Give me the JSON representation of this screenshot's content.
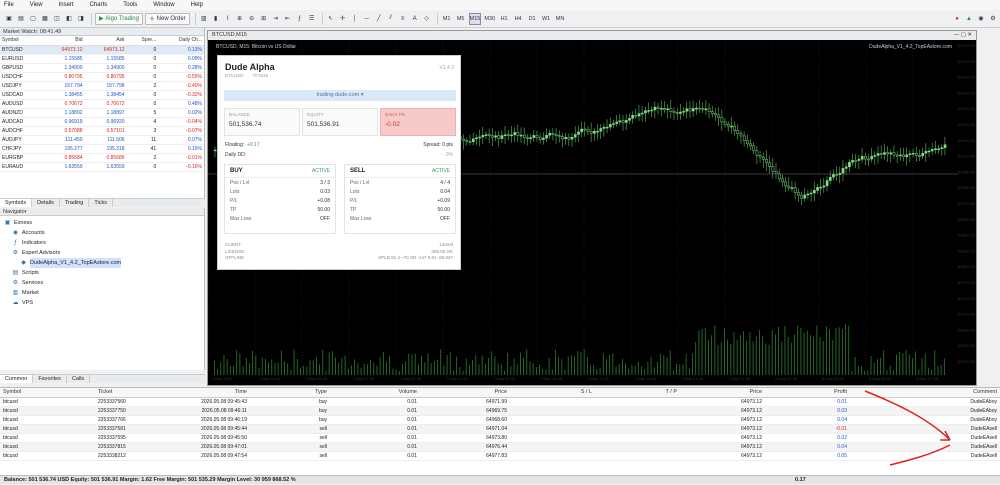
{
  "menu": [
    "File",
    "View",
    "Insert",
    "Charts",
    "Tools",
    "Window",
    "Help"
  ],
  "toolbar": {
    "algo_trading": "Algo Trading",
    "new_order": "New Order",
    "timeframes": [
      "M1",
      "M5",
      "M15",
      "M30",
      "H1",
      "H4",
      "D1",
      "W1",
      "MN"
    ],
    "active_timeframe": "M15"
  },
  "market_watch": {
    "title": "Market Watch: 08:41:49",
    "headers": [
      "Symbol",
      "Bid",
      "Ask",
      "Spre...",
      "Daily Ch..."
    ],
    "rows": [
      [
        "BTCUSD",
        "64973.12",
        "64973.12",
        "0",
        "0.13%"
      ],
      [
        "EURUSD",
        "1.15585",
        "1.15585",
        "0",
        "0.09%"
      ],
      [
        "GBPUSD",
        "1.34900",
        "1.34900",
        "0",
        "0.28%"
      ],
      [
        "USDCHF",
        "0.80795",
        "0.80795",
        "0",
        "-0.55%"
      ],
      [
        "USDJPY",
        "157.794",
        "157.798",
        "2",
        "-0.40%"
      ],
      [
        "USDCAD",
        "1.38455",
        "1.38454",
        "0",
        "-0.32%"
      ],
      [
        "AUDUSD",
        "0.70672",
        "0.70672",
        "0",
        "0.48%"
      ],
      [
        "AUDNZD",
        "1.18892",
        "1.18897",
        "5",
        "0.02%"
      ],
      [
        "AUDCAD",
        "0.96919",
        "0.96920",
        "4",
        "-0.04%"
      ],
      [
        "AUDCHF",
        "0.57088",
        "0.57101",
        "3",
        "-0.07%"
      ],
      [
        "AUDJPY",
        "111.450",
        "111.506",
        "11",
        "0.07%"
      ],
      [
        "CHFJPY",
        "195.277",
        "195.318",
        "41",
        "0.15%"
      ],
      [
        "EURGBP",
        "0.85684",
        "0.85686",
        "2",
        "-0.01%"
      ],
      [
        "EURAUD",
        "1.63559",
        "1.63559",
        "0",
        "-0.16%"
      ]
    ],
    "tabs": [
      "Symbols",
      "Details",
      "Trading",
      "Ticks"
    ]
  },
  "navigator": {
    "title": "Navigator",
    "items": [
      {
        "label": "Exness",
        "level": 0,
        "icon": "folder-icon"
      },
      {
        "label": "Accounts",
        "level": 1,
        "icon": "accounts-icon"
      },
      {
        "label": "Indicators",
        "level": 1,
        "icon": "indicators-icon"
      },
      {
        "label": "Expert Advisors",
        "level": 1,
        "icon": "expert-icon"
      },
      {
        "label": "DudeAlpha_V1_4.2_TopEAstore.com",
        "level": 2,
        "icon": "ea-icon",
        "selected": true
      },
      {
        "label": "Scripts",
        "level": 1,
        "icon": "scripts-icon"
      },
      {
        "label": "Services",
        "level": 1,
        "icon": "services-icon"
      },
      {
        "label": "Market",
        "level": 1,
        "icon": "market-icon"
      },
      {
        "label": "VPS",
        "level": 1,
        "icon": "vps-icon"
      }
    ]
  },
  "chart": {
    "title": "BTCUSD,M15",
    "subtitle": "BTCUSD, M15: Bitcoin vs US Dollar",
    "ea_label": "DudeAlpha_V1_4.2_TopEAstore.com",
    "price_ticks": [
      "64220.00",
      "64190.00",
      "64160.00",
      "64130.00",
      "64100.00",
      "64070.00",
      "64040.00",
      "64010.00",
      "63980.00",
      "63950.00",
      "63920.00",
      "63890.00",
      "63860.00",
      "63830.00",
      "63800.00",
      "63770.00",
      "63740.00",
      "63710.00",
      "63680.00",
      "63650.00",
      "63620.00"
    ],
    "time_ticks": [
      "7 May 2026",
      "7 May 03:45",
      "7 May 05:45",
      "7 May 07:45",
      "7 May 09:45",
      "7 May 11:45",
      "7 May 13:45",
      "7 May 15:45",
      "7 May 17:45",
      "7 May 19:45",
      "7 May 21:45",
      "7 May 23:45",
      "8 May 01:45",
      "8 May 03:45",
      "8 May 05:45",
      "8 May 07:45"
    ],
    "colors": {
      "background": "#000000",
      "bull": "#7ee081",
      "bear": "#3fa34d",
      "volume": "#2e7d32"
    }
  },
  "panel": {
    "title": "Dude Alpha",
    "version": "V1.4.2",
    "sub_left": "BTCUSD",
    "sub_right": "TF:M15",
    "banner": "trading-dude.com",
    "boxes": [
      {
        "label": "BALANCE",
        "value": "501,536.74"
      },
      {
        "label": "EQUITY",
        "value": "501,536.91"
      },
      {
        "label": "DAILY P/L",
        "value": "-0.02"
      }
    ],
    "floating_label": "Floating:",
    "floating_value": "+0.17",
    "spread": "Spread: 0 pts",
    "daily_dd_label": "Daily DD:",
    "daily_dd_value": "0%",
    "buy": {
      "title": "BUY",
      "status": "ACTIVE",
      "rows": [
        [
          "Pos / Lvl",
          "3 / 3"
        ],
        [
          "Lots",
          "0.03"
        ],
        [
          "P/L",
          "+0.08"
        ],
        [
          "TP",
          "50.00"
        ],
        [
          "Max Loss",
          "OFF"
        ]
      ]
    },
    "sell": {
      "title": "SELL",
      "status": "ACTIVE",
      "rows": [
        [
          "Pos / Lvl",
          "4 / 4"
        ],
        [
          "Lots",
          "0.04"
        ],
        [
          "P/L",
          "+0.09"
        ],
        [
          "TP",
          "50.00"
        ],
        [
          "Max Loss",
          "OFF"
        ]
      ]
    },
    "footer_left": [
      "CLIENT",
      "LICENSE",
      "OFFLINE"
    ],
    "footer_right": [
      "12/end",
      "000.00 OK",
      "SPLD 91.4 ~70 SD -147 9.81 -86.047"
    ]
  },
  "toolbox_tabs": [
    "Common",
    "Favorites",
    "Calls"
  ],
  "trade": {
    "headers": [
      "Symbol",
      "Ticket",
      "Time",
      "Type",
      "Volume",
      "Price",
      "S / L",
      "T / P",
      "Price",
      "Profit",
      "Comment"
    ],
    "rows": [
      [
        "btcusd",
        "2253337560",
        "2026.05.08 09:45:43",
        "buy",
        "0.01",
        "64971.99",
        "",
        "",
        "64973.12",
        "0.01",
        "DudeEAboy"
      ],
      [
        "btcusd",
        "2253337750",
        "2026.05.08 09:46:11",
        "buy",
        "0.01",
        "64969.75",
        "",
        "",
        "64973.12",
        "0.03",
        "DudeEAboy"
      ],
      [
        "btcusd",
        "2253337766",
        "2026.05.08 09:46:19",
        "buy",
        "0.01",
        "64968.60",
        "",
        "",
        "64973.12",
        "0.04",
        "DudeEAboy"
      ],
      [
        "btcusd",
        "2253337581",
        "2026.05.08 09:45:44",
        "sell",
        "0.01",
        "64971.04",
        "",
        "",
        "64973.12",
        "-0.01",
        "DudeEAsell"
      ],
      [
        "btcusd",
        "2253337595",
        "2026.05.08 09:45:50",
        "sell",
        "0.01",
        "64973.80",
        "",
        "",
        "64973.12",
        "0.02",
        "DudeEAsell"
      ],
      [
        "btcusd",
        "2253337815",
        "2026.05.08 09:47:01",
        "sell",
        "0.01",
        "64976.44",
        "",
        "",
        "64973.12",
        "0.04",
        "DudeEAsell"
      ],
      [
        "btcusd",
        "2253338212",
        "2026.05.08 09:47:54",
        "sell",
        "0.01",
        "64977.83",
        "",
        "",
        "64973.12",
        "0.05",
        "DudeEAsell"
      ]
    ]
  },
  "status": {
    "text": "Balance: 501 536.74 USD  Equity: 501 536.91  Margin: 1.62  Free Margin: 501 535.29  Margin Level: 30 959 868.52 %",
    "profit": "0.17"
  }
}
